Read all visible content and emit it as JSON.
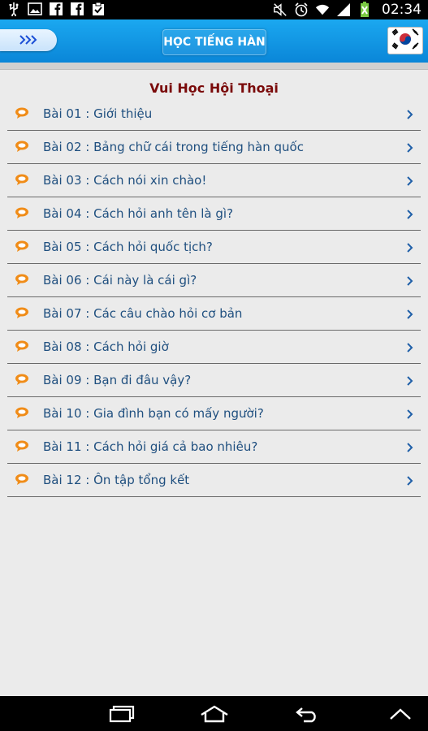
{
  "statusbar": {
    "time": "02:34",
    "left_icons": [
      "usb-icon",
      "image-icon",
      "facebook-icon",
      "facebook-icon",
      "clipboard-check-icon"
    ],
    "right_icons": [
      "mute-icon",
      "alarm-icon",
      "wifi-icon",
      "signal-icon",
      "battery-icon"
    ]
  },
  "header": {
    "title": "HỌC TIẾNG HÀN",
    "menu_icon": "chevrons-right-icon",
    "flag_icon": "korea-flag-icon"
  },
  "section": {
    "title": "Vui Học Hội Thoại"
  },
  "lessons": [
    {
      "label": "Bài 01 : Giới thiệu"
    },
    {
      "label": "Bài 02 : Bảng chữ cái trong tiếng hàn quốc"
    },
    {
      "label": "Bài 03 : Cách nói xin chào!"
    },
    {
      "label": "Bài 04 : Cách hỏi anh tên là gì?"
    },
    {
      "label": "Bài 05 : Cách hỏi quốc tịch?"
    },
    {
      "label": "Bài 06 : Cái này là cái gì?"
    },
    {
      "label": "Bài 07 : Các câu chào hỏi cơ bản"
    },
    {
      "label": "Bài 08 : Cách hỏi giờ"
    },
    {
      "label": "Bài 09 : Bạn đi đâu vậy?"
    },
    {
      "label": "Bài 10 : Gia đình bạn có mấy người?"
    },
    {
      "label": "Bài 11 : Cách hỏi giá cả bao nhiêu?"
    },
    {
      "label": "Bài 12 : Ôn tập tổng kết"
    }
  ],
  "navbar": [
    "recent-apps-icon",
    "home-icon",
    "back-icon",
    "menu-up-icon"
  ],
  "colors": {
    "accent": "#0a86d8",
    "title": "#7a0a0a",
    "item_text": "#1f4f7f",
    "bubble": "#f08c18"
  }
}
